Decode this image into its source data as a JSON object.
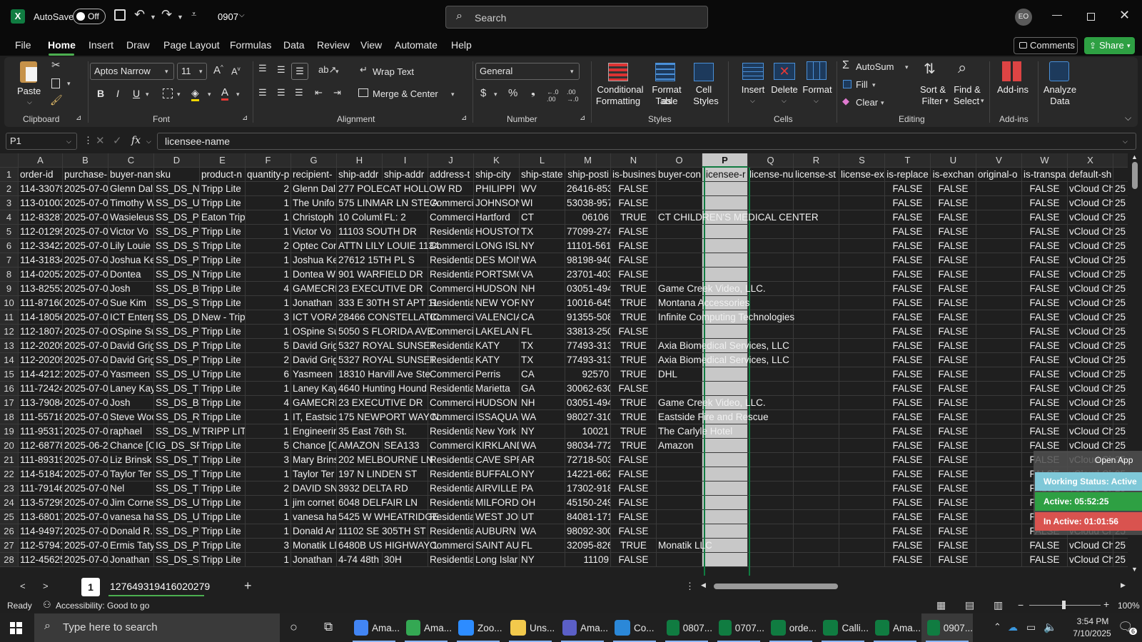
{
  "titlebar": {
    "autosave_label": "AutoSave",
    "autosave_state": "Off",
    "filename": "0907",
    "search_placeholder": "Search",
    "user_initials": "EO"
  },
  "menu": [
    "File",
    "Home",
    "Insert",
    "Draw",
    "Page Layout",
    "Formulas",
    "Data",
    "Review",
    "View",
    "Automate",
    "Help"
  ],
  "active_menu": "Home",
  "comments_label": "Comments",
  "share_label": "Share",
  "ribbon": {
    "paste": "Paste",
    "clipboard": "Clipboard",
    "font_name": "Aptos Narrow",
    "font_size": "11",
    "font_group": "Font",
    "wrap_text": "Wrap Text",
    "merge_center": "Merge & Center",
    "alignment_group": "Alignment",
    "number_format": "General",
    "number_group": "Number",
    "conditional_formatting": [
      "Conditional",
      "Formatting"
    ],
    "format_as_table": [
      "Format as",
      "Table"
    ],
    "cell_styles": [
      "Cell",
      "Styles"
    ],
    "styles_group": "Styles",
    "insert": "Insert",
    "delete": "Delete",
    "format": "Format",
    "cells_group": "Cells",
    "autosum": "AutoSum",
    "fill": "Fill",
    "clear": "Clear",
    "sort_filter": [
      "Sort &",
      "Filter"
    ],
    "find_select": [
      "Find &",
      "Select"
    ],
    "editing_group": "Editing",
    "add_ins": "Add-ins",
    "add_ins_group": "Add-ins",
    "analyze_data": [
      "Analyze",
      "Data"
    ],
    "bold": "B",
    "italic": "I",
    "underline": "U"
  },
  "formula": {
    "name_box": "P1",
    "content": "licensee-name",
    "fx": "fx"
  },
  "columns": [
    "A",
    "B",
    "C",
    "D",
    "E",
    "F",
    "G",
    "H",
    "I",
    "J",
    "K",
    "L",
    "M",
    "N",
    "O",
    "P",
    "Q",
    "R",
    "S",
    "T",
    "U",
    "V",
    "W",
    "X"
  ],
  "selected_column": "P",
  "rows": [
    [
      "order-id",
      "purchase-",
      "buyer-nan",
      "sku",
      "product-n",
      "quantity-p",
      "recipient-",
      "ship-addr",
      "ship-addr",
      "address-t",
      "ship-city",
      "ship-state",
      "ship-posti",
      "is-busines",
      "buyer-con",
      "licensee-r",
      "license-nu",
      "license-st",
      "license-ex",
      "is-replace",
      "is-exchan",
      "original-o",
      "is-transpa",
      "default-sh"
    ],
    [
      "114-33079",
      "2025-07-0:",
      "Glenn Dal",
      "SS_DS_N2",
      "Tripp Lite",
      "2",
      "Glenn Dal",
      "277 POLECAT HOLLOW RD",
      "",
      "",
      "PHILIPPI",
      "WV",
      "26416-853",
      "FALSE",
      "",
      "",
      "",
      "",
      "",
      "FALSE",
      "FALSE",
      "",
      "FALSE",
      "vCloud Ch"
    ],
    [
      "113-01003",
      "2025-07-0:",
      "Timothy W",
      "SS_DS_U0",
      "Tripp Lite",
      "1",
      "The Unifo",
      "575 LINMAR LN STE A",
      "",
      "Commerci",
      "JOHNSON",
      "WI",
      "53038-957",
      "FALSE",
      "",
      "",
      "",
      "",
      "",
      "FALSE",
      "FALSE",
      "",
      "FALSE",
      "vCloud Ch"
    ],
    [
      "112-83287",
      "2025-07-0:",
      "Wasieleus",
      "SS_DS_P5",
      "Eaton Trip",
      "1",
      "Christoph",
      "10 Columb",
      "FL: 2",
      "Commerci",
      "Hartford",
      "CT",
      "06106",
      "TRUE",
      "CT CHILDREN'S MEDICAL CENTER",
      "",
      "",
      "",
      "",
      "FALSE",
      "FALSE",
      "",
      "FALSE",
      "vCloud Ch"
    ],
    [
      "112-01295",
      "2025-07-0:",
      "Victor Vo",
      "SS_DS_P0",
      "Tripp Lite",
      "1",
      "Victor Vo",
      "11103 SOUTH DR",
      "",
      "Residentia",
      "HOUSTON",
      "TX",
      "77099-274",
      "FALSE",
      "",
      "",
      "",
      "",
      "",
      "FALSE",
      "FALSE",
      "",
      "FALSE",
      "vCloud Ch"
    ],
    [
      "112-33422",
      "2025-07-0:",
      "Lily Louie",
      "SS_DS_SR",
      "Tripp Lite",
      "2",
      "Optec Con",
      "ATTN LILY LOUIE 1134",
      "",
      "Commerci",
      "LONG ISLA",
      "NY",
      "11101-561",
      "FALSE",
      "",
      "",
      "",
      "",
      "",
      "FALSE",
      "FALSE",
      "",
      "FALSE",
      "vCloud Ch"
    ],
    [
      "114-31834",
      "2025-07-0:",
      "Joshua Ke",
      "SS_DS_P0",
      "Tripp Lite",
      "1",
      "Joshua Ke",
      "27612 15TH PL S",
      "",
      "Residentia",
      "DES MOIN",
      "WA",
      "98198-940",
      "FALSE",
      "",
      "",
      "",
      "",
      "",
      "FALSE",
      "FALSE",
      "",
      "FALSE",
      "vCloud Ch"
    ],
    [
      "114-02052",
      "2025-07-0:",
      "Dontea",
      "SS_DS_N2",
      "Tripp Lite",
      "1",
      "Dontea W",
      "901 WARFIELD DR",
      "",
      "Residentia",
      "PORTSMO",
      "VA",
      "23701-403",
      "FALSE",
      "",
      "",
      "",
      "",
      "",
      "FALSE",
      "FALSE",
      "",
      "FALSE",
      "vCloud Ch"
    ],
    [
      "113-82553",
      "2025-07-0:",
      "Josh",
      "SS_DS_B0",
      "Tripp Lite",
      "4",
      "GAMECRE",
      "23 EXECUTIVE DR",
      "",
      "Commerci",
      "HUDSON",
      "NH",
      "03051-494",
      "TRUE",
      "Game Creek Video, LLC.",
      "",
      "",
      "",
      "",
      "FALSE",
      "FALSE",
      "",
      "FALSE",
      "vCloud Ch"
    ],
    [
      "111-87160",
      "2025-07-0:",
      "Sue Kim",
      "SS_DS_SW",
      "Tripp Lite",
      "1",
      "Jonathan",
      "333 E 30TH ST APT 11",
      "",
      "Residentia",
      "NEW YORK",
      "NY",
      "10016-645",
      "TRUE",
      "Montana Accessories",
      "",
      "",
      "",
      "",
      "FALSE",
      "FALSE",
      "",
      "FALSE",
      "vCloud Ch"
    ],
    [
      "114-18056",
      "2025-07-0:",
      "ICT Enterp",
      "SS_DS_DC",
      "New - Trip",
      "3",
      "ICT VORA",
      "28466 CONSTELLATIC",
      "",
      "Commerci",
      "VALENCIA",
      "CA",
      "91355-508",
      "TRUE",
      "Infinite Computing Technologies",
      "",
      "",
      "",
      "",
      "FALSE",
      "FALSE",
      "",
      "FALSE",
      "vCloud Ch"
    ],
    [
      "112-18074",
      "2025-07-0:",
      "OSpine Su",
      "SS_DS_P0",
      "Tripp Lite",
      "1",
      "OSpine Su",
      "5050 S FLORIDA AVE",
      "",
      "Commerci",
      "LAKELAND",
      "FL",
      "33813-250",
      "FALSE",
      "",
      "",
      "",
      "",
      "",
      "FALSE",
      "FALSE",
      "",
      "FALSE",
      "vCloud Ch"
    ],
    [
      "112-20209",
      "2025-07-0:",
      "David Grig",
      "SS_DS_P0",
      "Tripp Lite",
      "5",
      "David Grig",
      "5327 ROYAL SUNSET",
      "",
      "Residentia",
      "KATY",
      "TX",
      "77493-313",
      "TRUE",
      "Axia Biomedical Services, LLC",
      "",
      "",
      "",
      "",
      "FALSE",
      "FALSE",
      "",
      "FALSE",
      "vCloud Ch"
    ],
    [
      "112-20209",
      "2025-07-0:",
      "David Grig",
      "SS_DS_P0",
      "Tripp Lite",
      "2",
      "David Grig",
      "5327 ROYAL SUNSET",
      "",
      "Residentia",
      "KATY",
      "TX",
      "77493-313",
      "TRUE",
      "Axia Biomedical Services, LLC",
      "",
      "",
      "",
      "",
      "FALSE",
      "FALSE",
      "",
      "FALSE",
      "vCloud Ch"
    ],
    [
      "114-42121",
      "2025-07-0:",
      "Yasmeen",
      "SS_DS_UL",
      "Tripp Lite",
      "6",
      "Yasmeen",
      "18310 Harvill Ave Ste",
      "",
      "Commerci",
      "Perris",
      "CA",
      "92570",
      "TRUE",
      "DHL",
      "",
      "",
      "",
      "",
      "FALSE",
      "FALSE",
      "",
      "FALSE",
      "vCloud Ch"
    ],
    [
      "111-72424",
      "2025-07-0:",
      "Laney Kay",
      "SS_DS_TL",
      "Tripp Lite",
      "1",
      "Laney Kay",
      "4640 Hunting Hound",
      "",
      "Residentia",
      "Marietta",
      "GA",
      "30062-630",
      "FALSE",
      "",
      "",
      "",
      "",
      "",
      "FALSE",
      "FALSE",
      "",
      "FALSE",
      "vCloud Ch"
    ],
    [
      "113-79084",
      "2025-07-0:",
      "Josh",
      "SS_DS_B0",
      "Tripp Lite",
      "4",
      "GAMECRE",
      "23 EXECUTIVE DR",
      "",
      "Commerci",
      "HUDSON",
      "NH",
      "03051-494",
      "TRUE",
      "Game Creek Video, LLC.",
      "",
      "",
      "",
      "",
      "FALSE",
      "FALSE",
      "",
      "FALSE",
      "vCloud Ch"
    ],
    [
      "111-55718",
      "2025-07-0:",
      "Steve Woo",
      "SS_DS_RB",
      "Tripp Lite",
      "1",
      "IT, Eastsic",
      "175 NEWPORT WAY N",
      "",
      "Commerci",
      "ISSAQUAH",
      "WA",
      "98027-310",
      "TRUE",
      "Eastside Fire and Rescue",
      "",
      "",
      "",
      "",
      "FALSE",
      "FALSE",
      "",
      "FALSE",
      "vCloud Ch"
    ],
    [
      "111-95317",
      "2025-07-0:",
      "raphael",
      "SS_DS_M1",
      "TRIPP LITE",
      "1",
      "Engineerir",
      "35 East 76th St.",
      "",
      "Residentia",
      "New York",
      "NY",
      "10021",
      "TRUE",
      "The Carlyle Hotel",
      "",
      "",
      "",
      "",
      "FALSE",
      "FALSE",
      "",
      "FALSE",
      "vCloud Ch"
    ],
    [
      "112-68778",
      "2025-06-2",
      "Chance [C",
      "IG_DS_SR5",
      "Tripp Lite",
      "5",
      "Chance [C",
      "AMAZON",
      "SEA133",
      "Commerci",
      "KIRKLAND",
      "WA",
      "98034-772",
      "TRUE",
      "Amazon",
      "",
      "",
      "",
      "",
      "FALSE",
      "FALSE",
      "",
      "FALSE",
      "vCloud Ch"
    ],
    [
      "111-89319",
      "2025-07-0:",
      "Liz Brinsk",
      "SS_DS_TL",
      "Tripp Lite",
      "3",
      "Mary Brins",
      "202 MELBOURNE LN",
      "",
      "Residentia",
      "CAVE SPRI",
      "AR",
      "72718-503",
      "FALSE",
      "",
      "",
      "",
      "",
      "",
      "FALSE",
      "FALSE",
      "",
      "FALSE",
      "vCloud Ch"
    ],
    [
      "114-51842",
      "2025-07-0:",
      "Taylor Ter",
      "SS_DS_TL",
      "Tripp Lite",
      "1",
      "Taylor Ter",
      "197 N LINDEN ST",
      "",
      "Residentia",
      "BUFFALO",
      "NY",
      "14221-662",
      "FALSE",
      "",
      "",
      "",
      "",
      "",
      "FALSE",
      "FALSE",
      "",
      "FALSE",
      "vCloud Ch"
    ],
    [
      "111-79146",
      "2025-07-0:",
      "Nel",
      "SS_DS_TR",
      "Tripp Lite",
      "2",
      "DAVID SN",
      "3932 DELTA RD",
      "",
      "Residentia",
      "AIRVILLE",
      "PA",
      "17302-918",
      "FALSE",
      "",
      "",
      "",
      "",
      "",
      "FALSE",
      "FALSE",
      "",
      "FALSE",
      "vCloud Ch"
    ],
    [
      "113-57299",
      "2025-07-0:",
      "Jim Corne",
      "SS_DS_UL",
      "Tripp Lite",
      "1",
      "jim cornet",
      "6048 DELFAIR LN",
      "",
      "Residentia",
      "MILFORD",
      "OH",
      "45150-249",
      "FALSE",
      "",
      "",
      "",
      "",
      "",
      "FALSE",
      "FALSE",
      "",
      "FALSE",
      "vCloud Ch"
    ],
    [
      "113-68017",
      "2025-07-0:",
      "vanesa ha",
      "SS_DS_UR",
      "Tripp Lite",
      "1",
      "vanesa ha",
      "5425 W WHEATRIDGE",
      "",
      "Residentia",
      "WEST JOR",
      "UT",
      "84081-171",
      "FALSE",
      "",
      "",
      "",
      "",
      "",
      "FALSE",
      "FALSE",
      "",
      "FALSE",
      "vCloud Ch"
    ],
    [
      "114-94972",
      "2025-07-0:",
      "Donald R.",
      "SS_DS_P5",
      "Tripp Lite",
      "1",
      "Donald Ar",
      "11102 SE 305TH ST",
      "",
      "Residentia",
      "AUBURN",
      "WA",
      "98092-300",
      "FALSE",
      "",
      "",
      "",
      "",
      "",
      "FALSE",
      "FALSE",
      "",
      "FALSE",
      "vCloud Ch"
    ],
    [
      "112-57941",
      "2025-07-0:",
      "Ermis Taty",
      "SS_DS_P5",
      "Tripp Lite",
      "3",
      "Monatik Ll",
      "6480B US HIGHWAY 1",
      "",
      "Commerci",
      "SAINT AUG",
      "FL",
      "32095-826",
      "TRUE",
      "Monatik LLC",
      "",
      "",
      "",
      "",
      "FALSE",
      "FALSE",
      "",
      "FALSE",
      "vCloud Ch"
    ],
    [
      "112-45625",
      "2025-07-0:",
      "Jonathan",
      "SS_DS_SU",
      "Tripp Lite",
      "1",
      "Jonathan",
      "4-74 48th",
      "30H",
      "Residentia",
      "Long Islar",
      "NY",
      "11109",
      "FALSE",
      "",
      "",
      "",
      "",
      "",
      "FALSE",
      "FALSE",
      "",
      "FALSE",
      "vCloud Ch"
    ]
  ],
  "col_y_partial": "25",
  "sheet_tab": "127649319416020279",
  "sheet_nav_num": "1",
  "status": {
    "ready": "Ready",
    "accessibility": "Accessibility: Good to go",
    "zoom": "100%"
  },
  "overlay": {
    "open_app": "Open App",
    "working_status": "Working Status: Active",
    "active_time": "Active: 05:52:25",
    "inactive_time": "In Active: 01:01:56"
  },
  "taskbar": {
    "search_placeholder": "Type here to search",
    "apps": [
      {
        "label": "Ama...",
        "color": "#4285f4"
      },
      {
        "label": "Ama...",
        "color": "#34a853"
      },
      {
        "label": "Zoo...",
        "color": "#2d8cff"
      },
      {
        "label": "Uns...",
        "color": "#f2c94c"
      },
      {
        "label": "Ama...",
        "color": "#5b5fc7"
      },
      {
        "label": "Co...",
        "color": "#2b88d8"
      },
      {
        "label": "0807...",
        "color": "#107c41"
      },
      {
        "label": "0707...",
        "color": "#107c41"
      },
      {
        "label": "orde...",
        "color": "#107c41"
      },
      {
        "label": "Calli...",
        "color": "#107c41"
      },
      {
        "label": "Ama...",
        "color": "#107c41"
      },
      {
        "label": "0907...",
        "color": "#107c41"
      }
    ],
    "time": "3:54 PM",
    "date": "7/10/2025",
    "notif_count": "6"
  },
  "colors": {
    "excel_green": "#107c41",
    "accent_green": "#2ea043",
    "selection": "#c8c8c8",
    "active_tab_underline": "#4caf50"
  }
}
